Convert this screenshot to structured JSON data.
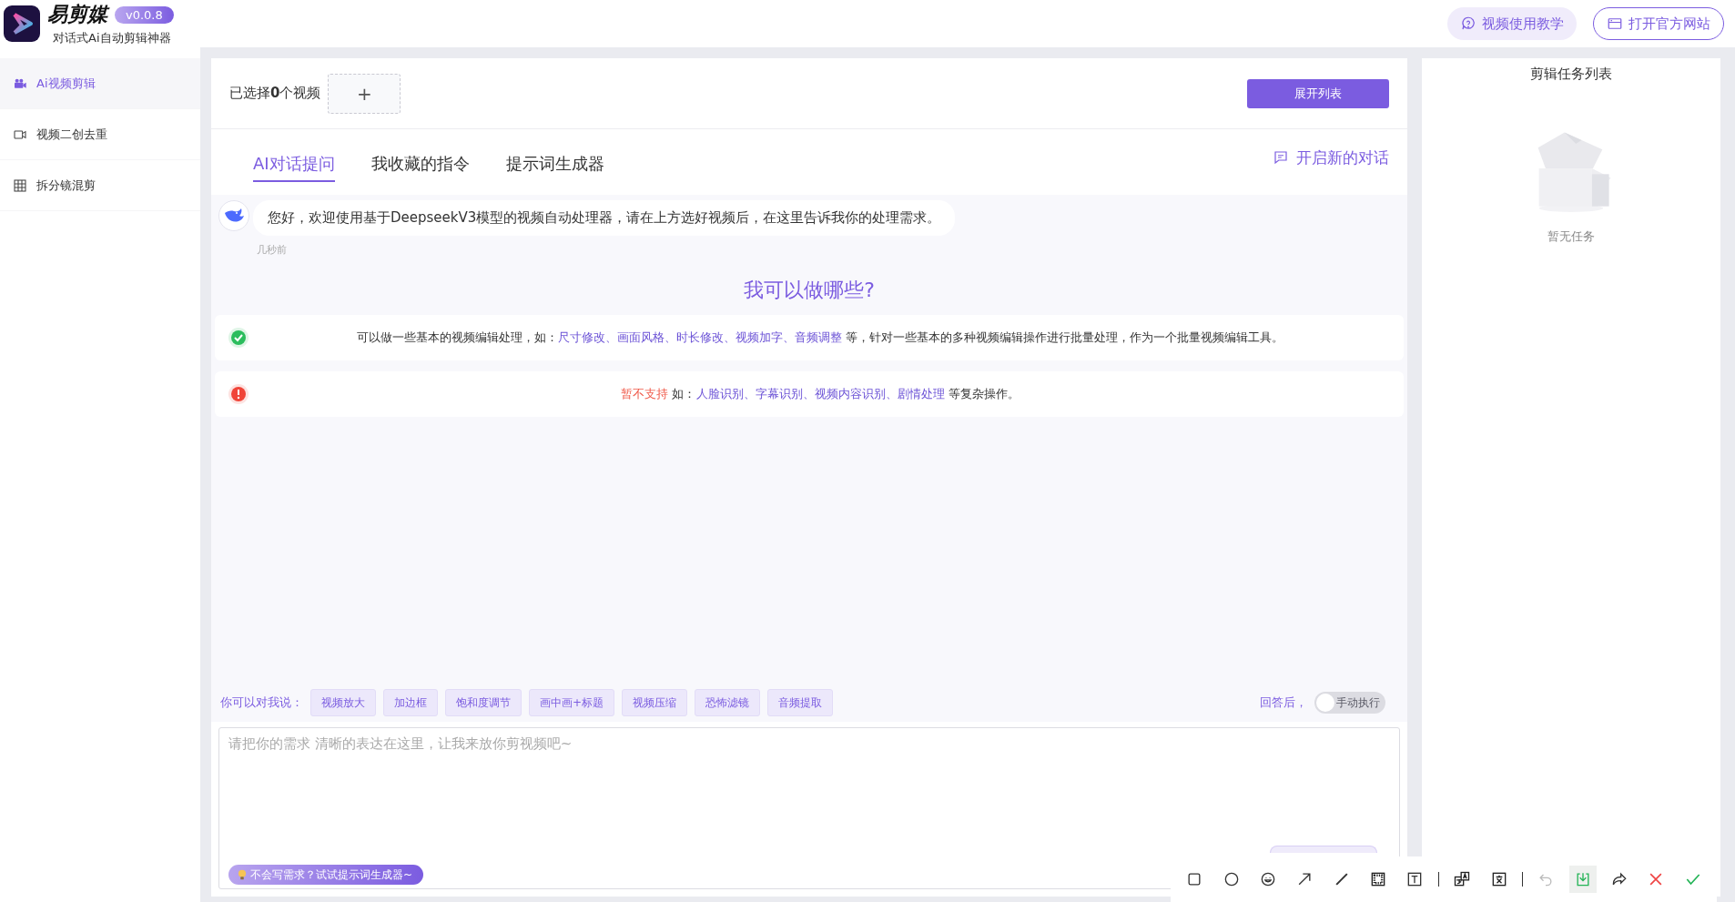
{
  "app": {
    "name": "易剪媒",
    "version": "v0.0.8",
    "tagline": "对话式Ai自动剪辑神器"
  },
  "header_actions": [
    {
      "label": "视频使用教学",
      "kind": "soft"
    },
    {
      "label": "打开官方网站",
      "kind": "outline"
    }
  ],
  "sidebar": {
    "items": [
      {
        "label": "Ai视频剪辑",
        "selected": true
      },
      {
        "label": "视频二创去重",
        "selected": false
      },
      {
        "label": "拆分镜混剪",
        "selected": false
      }
    ]
  },
  "selection": {
    "label": "已选择**0**个视频",
    "add": "+",
    "expand_button": "展开列表"
  },
  "tabs": [
    {
      "label": "AI对话提问",
      "selected": true
    },
    {
      "label": "我收藏的指令",
      "selected": false
    },
    {
      "label": "提示词生成器",
      "selected": false
    }
  ],
  "new_chat": "开启新的对话",
  "message": {
    "text": "您好，欢迎使用基于DeepseekV3模型的视频自动处理器，请在上方选好视频后，在这里告诉我你的处理需求。",
    "time": "几秒前"
  },
  "capabilities": {
    "title": "我可以做哪些?",
    "items": [
      {
        "kind": "supported",
        "segments": [
          {
            "text": "可以做一些基本的视频编辑处理，如：",
            "kind": "plain"
          },
          {
            "text": "尺寸修改、画面风格、时长修改、视频加字、音频调整",
            "kind": "highlight"
          },
          {
            "text": " 等，针对一些基本的多种视频编辑操作进行批量处理，作为一个批量视频编辑工具。",
            "kind": "plain"
          }
        ]
      },
      {
        "kind": "unsupported",
        "segments": [
          {
            "text": "暂不支持",
            "kind": "warning"
          },
          {
            "text": " 如：",
            "kind": "plain"
          },
          {
            "text": "人脸识别、字幕识别、视频内容识别、剧情处理",
            "kind": "highlight"
          },
          {
            "text": " 等复杂操作。",
            "kind": "plain"
          }
        ]
      }
    ]
  },
  "suggestions": {
    "label": "你可以对我说：",
    "chips": [
      "视频放大",
      "加边框",
      "饱和度调节",
      "画中画+标题",
      "视频压缩",
      "恐怖滤镜",
      "音频提取"
    ]
  },
  "auto_run": {
    "label": "回答后，",
    "toggle_text": "手动执行",
    "on": false
  },
  "input": {
    "placeholder": "请把你的需求 清晰的表达在这里，让我来放你剪视频吧~",
    "hint": "不会写需求？试试提示词生成器~"
  },
  "tasks": {
    "title": "剪辑任务列表",
    "empty": "暂无任务"
  }
}
